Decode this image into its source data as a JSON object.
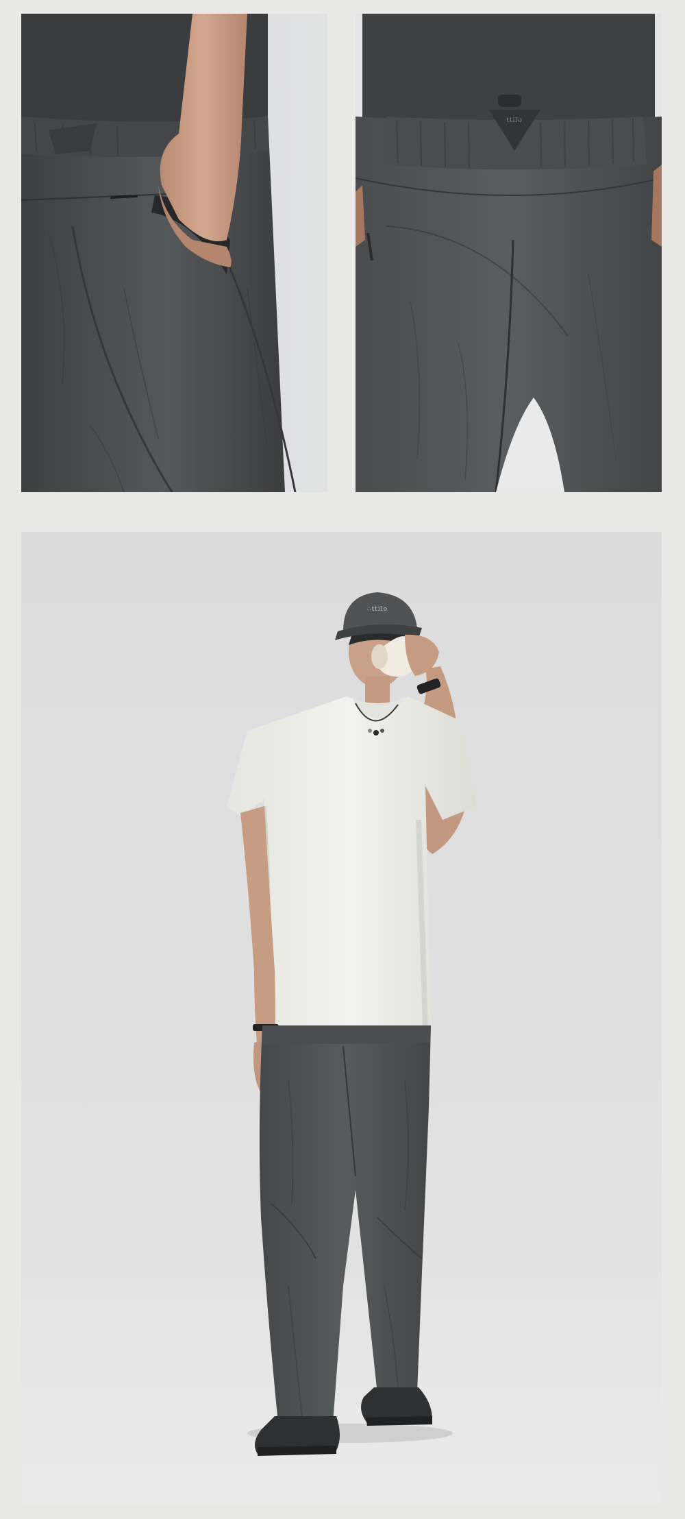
{
  "page": {
    "background_color": "#e9e9e8"
  },
  "photos": [
    {
      "id": "detail-left",
      "subject": "pants-side-pocket-detail",
      "dominant_color": "#4a4b4b"
    },
    {
      "id": "detail-right",
      "subject": "pants-back-waistband-detail",
      "dominant_color": "#4c4d4d"
    },
    {
      "id": "full-look",
      "subject": "full-body-model-outfit",
      "backdrop_color": "#dfdfdf"
    }
  ],
  "branding": {
    "cap_logo_text": "∴ttilo",
    "patch_logo_text": "ttilo"
  },
  "palette": {
    "pants": "#4d4e4f",
    "tee": "#eeeeea",
    "tee_shadow": "#d8d8d2",
    "cap": "#505253",
    "shoes": "#2f3031",
    "skin": "#c79c82",
    "cup": "#f1ebe2"
  }
}
